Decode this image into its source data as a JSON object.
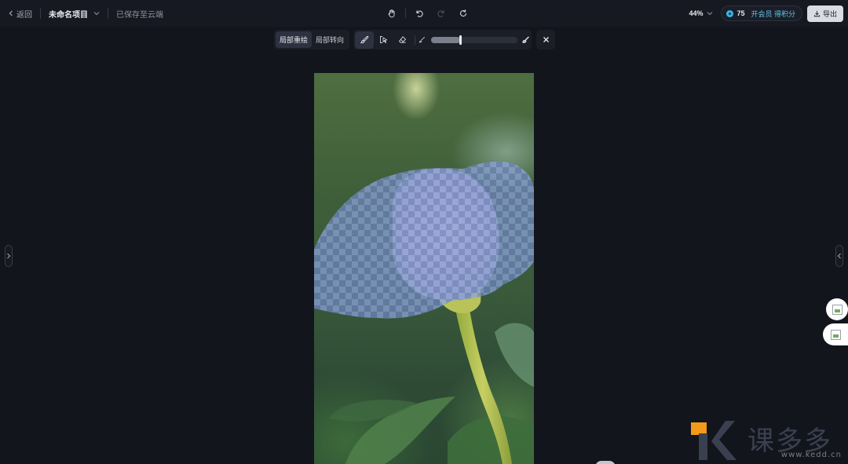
{
  "header": {
    "back_label": "返回",
    "project_name": "未命名项目",
    "save_status": "已保存至云端",
    "zoom": "44%",
    "credits": "75",
    "member_label": "开会员 得积分",
    "export_label": "导出"
  },
  "toolbar": {
    "modes": [
      {
        "label": "局部重绘",
        "active": true
      },
      {
        "label": "局部转向",
        "active": false
      }
    ],
    "tools": [
      "brush-icon",
      "smart-select-icon",
      "eraser-icon"
    ],
    "brush_size_fraction": 0.34
  },
  "colors": {
    "background": "#13151c",
    "accent": "#5fc6f0",
    "mask": "#8fb3ff"
  },
  "watermark": {
    "cn": "课多多",
    "url": "www.kedd.cn"
  }
}
